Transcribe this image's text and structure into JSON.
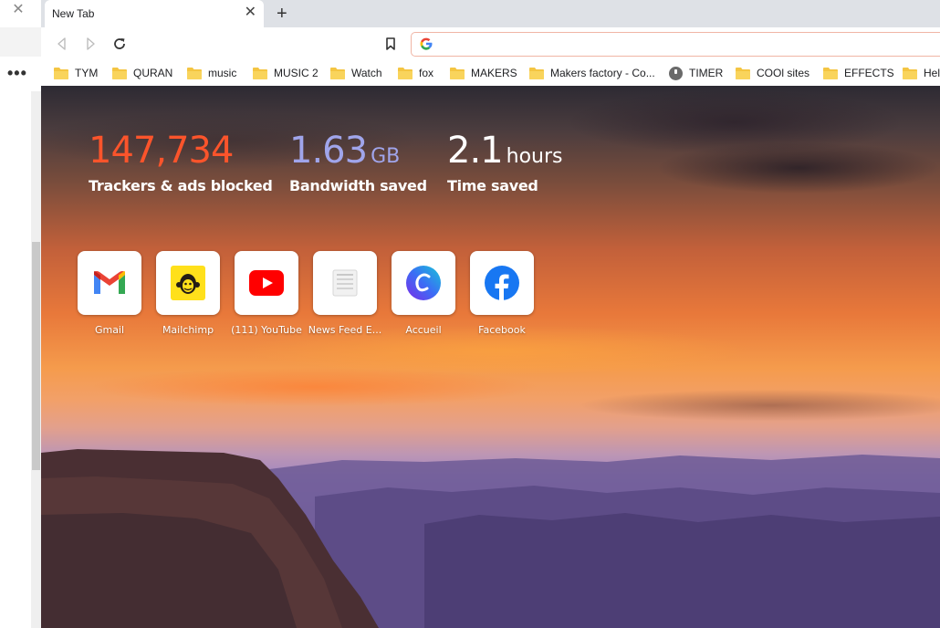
{
  "side": {
    "close_glyph": "✕",
    "more_glyph": "•••"
  },
  "tab": {
    "title": "New Tab",
    "close_glyph": "✕"
  },
  "new_tab_glyph": "+",
  "omnibox": {
    "value": "",
    "placeholder": ""
  },
  "bookmarks": [
    {
      "label": "TYM",
      "icon": "folder-icon"
    },
    {
      "label": "QURAN",
      "icon": "folder-icon"
    },
    {
      "label": "music",
      "icon": "folder-icon"
    },
    {
      "label": "MUSIC 2",
      "icon": "folder-icon"
    },
    {
      "label": "Watch",
      "icon": "folder-icon"
    },
    {
      "label": "fox",
      "icon": "folder-icon"
    },
    {
      "label": "MAKERS",
      "icon": "folder-icon"
    },
    {
      "label": "Makers factory - Co...",
      "icon": "folder-icon"
    },
    {
      "label": "TIMER",
      "icon": "timer-icon"
    },
    {
      "label": "COOl sites",
      "icon": "folder-icon"
    },
    {
      "label": "EFFECTS",
      "icon": "folder-icon"
    },
    {
      "label": "Hel",
      "icon": "folder-icon"
    }
  ],
  "stats": {
    "trackers": {
      "value": "147,734",
      "unit": "",
      "label": "Trackers & ads blocked",
      "color": "#fb542b"
    },
    "bandwidth": {
      "value": "1.63",
      "unit": "GB",
      "label": "Bandwidth saved",
      "color": "#a0a5eb"
    },
    "time": {
      "value": "2.1",
      "unit": "hours",
      "label": "Time saved",
      "color": "#ffffff"
    }
  },
  "tiles": [
    {
      "label": "Gmail",
      "icon": "gmail-icon"
    },
    {
      "label": "Mailchimp",
      "icon": "mailchimp-icon"
    },
    {
      "label": "(111) YouTube",
      "icon": "youtube-icon"
    },
    {
      "label": "News Feed E...",
      "icon": "news-feed-icon"
    },
    {
      "label": "Accueil",
      "icon": "canva-icon"
    },
    {
      "label": "Facebook",
      "icon": "facebook-icon"
    }
  ]
}
